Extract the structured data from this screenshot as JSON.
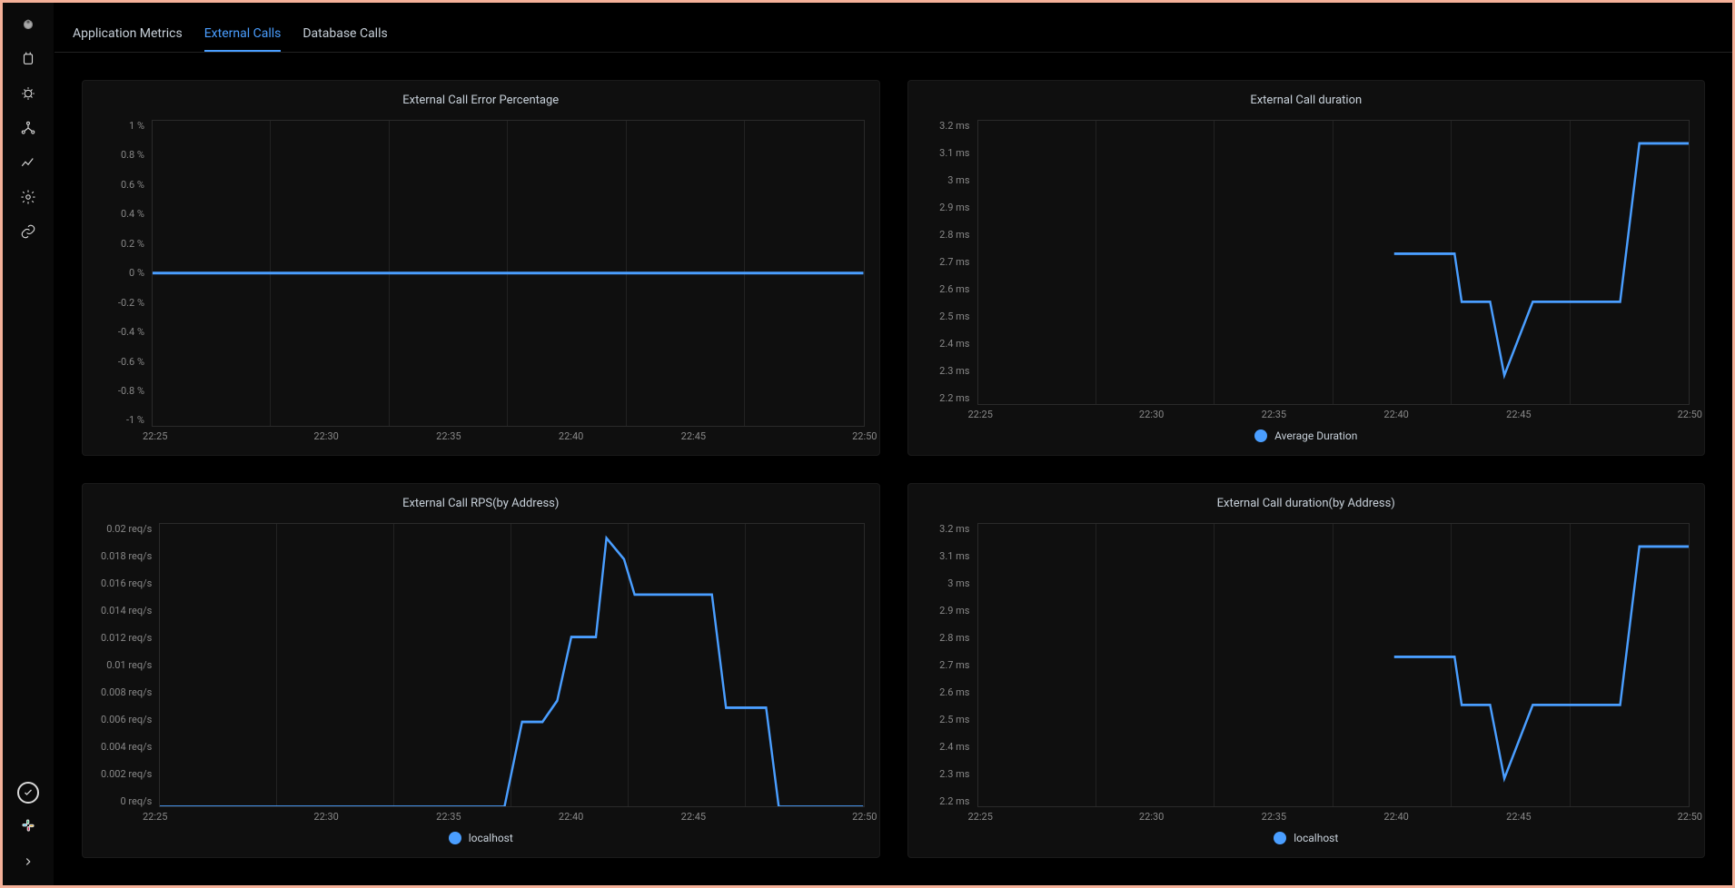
{
  "tabs": [
    {
      "label": "Application Metrics",
      "active": false
    },
    {
      "label": "External Calls",
      "active": true
    },
    {
      "label": "Database Calls",
      "active": false
    }
  ],
  "sidebar": {
    "icons": [
      "dashboard",
      "alerts",
      "bugs",
      "services",
      "metrics",
      "settings",
      "link"
    ]
  },
  "chart_data": [
    {
      "id": "error-pct",
      "type": "line",
      "title": "External Call Error Percentage",
      "ylabel": "",
      "x": [
        "22:25",
        "22:30",
        "22:35",
        "22:40",
        "22:45",
        "22:50"
      ],
      "yticks": [
        "1 %",
        "0.8 %",
        "0.6 %",
        "0.4 %",
        "0.2 %",
        "0 %",
        "-0.2 %",
        "-0.4 %",
        "-0.6 %",
        "-0.8 %",
        "-1 %"
      ],
      "ylim": [
        -1,
        1
      ],
      "series": [
        {
          "name": "",
          "values": [
            0,
            0,
            0,
            0,
            0,
            0,
            0,
            0,
            0,
            0,
            0,
            0,
            0,
            0,
            0,
            0,
            0,
            0,
            0,
            0,
            0,
            0,
            0,
            0,
            0,
            0
          ]
        }
      ],
      "legend": []
    },
    {
      "id": "duration",
      "type": "line",
      "title": "External Call duration",
      "ylabel": "",
      "x": [
        "22:25",
        "22:30",
        "22:35",
        "22:40",
        "22:45",
        "22:50"
      ],
      "yticks": [
        "3.2 ms",
        "3.1 ms",
        "3 ms",
        "2.9 ms",
        "2.8 ms",
        "2.7 ms",
        "2.6 ms",
        "2.5 ms",
        "2.4 ms",
        "2.3 ms",
        "2.2 ms"
      ],
      "ylim": [
        2.2,
        3.2
      ],
      "series": [
        {
          "name": "Average Duration",
          "values_segment": {
            "start_fraction": 0.585,
            "points": [
              [
                0.585,
                2.73
              ],
              [
                0.67,
                2.73
              ],
              [
                0.68,
                2.56
              ],
              [
                0.72,
                2.56
              ],
              [
                0.74,
                2.3
              ],
              [
                0.78,
                2.56
              ],
              [
                0.79,
                2.56
              ],
              [
                0.903,
                2.56
              ],
              [
                0.93,
                3.12
              ],
              [
                1.0,
                3.12
              ]
            ]
          }
        }
      ],
      "legend": [
        "Average Duration"
      ]
    },
    {
      "id": "rps",
      "type": "line",
      "title": "External Call RPS(by Address)",
      "ylabel": "",
      "x": [
        "22:25",
        "22:30",
        "22:35",
        "22:40",
        "22:45",
        "22:50"
      ],
      "yticks": [
        "0.02 req/s",
        "0.018 req/s",
        "0.016 req/s",
        "0.014 req/s",
        "0.012 req/s",
        "0.01 req/s",
        "0.008 req/s",
        "0.006 req/s",
        "0.004 req/s",
        "0.002 req/s",
        "0 req/s"
      ],
      "ylim": [
        0,
        0.02
      ],
      "series": [
        {
          "name": "localhost",
          "values_segment": {
            "start_fraction": 0.0,
            "points": [
              [
                0.0,
                0
              ],
              [
                0.49,
                0
              ],
              [
                0.515,
                0.006
              ],
              [
                0.544,
                0.006
              ],
              [
                0.565,
                0.0075
              ],
              [
                0.585,
                0.012
              ],
              [
                0.62,
                0.012
              ],
              [
                0.635,
                0.019
              ],
              [
                0.66,
                0.0175
              ],
              [
                0.675,
                0.015
              ],
              [
                0.785,
                0.015
              ],
              [
                0.805,
                0.007
              ],
              [
                0.862,
                0.007
              ],
              [
                0.88,
                0
              ],
              [
                1.0,
                0
              ]
            ]
          }
        }
      ],
      "legend": [
        "localhost"
      ]
    },
    {
      "id": "duration-addr",
      "type": "line",
      "title": "External Call duration(by Address)",
      "ylabel": "",
      "x": [
        "22:25",
        "22:30",
        "22:35",
        "22:40",
        "22:45",
        "22:50"
      ],
      "yticks": [
        "3.2 ms",
        "3.1 ms",
        "3 ms",
        "2.9 ms",
        "2.8 ms",
        "2.7 ms",
        "2.6 ms",
        "2.5 ms",
        "2.4 ms",
        "2.3 ms",
        "2.2 ms"
      ],
      "ylim": [
        2.2,
        3.2
      ],
      "series": [
        {
          "name": "localhost",
          "values_segment": {
            "start_fraction": 0.585,
            "points": [
              [
                0.585,
                2.73
              ],
              [
                0.67,
                2.73
              ],
              [
                0.68,
                2.56
              ],
              [
                0.72,
                2.56
              ],
              [
                0.74,
                2.3
              ],
              [
                0.78,
                2.56
              ],
              [
                0.79,
                2.56
              ],
              [
                0.903,
                2.56
              ],
              [
                0.93,
                3.12
              ],
              [
                1.0,
                3.12
              ]
            ]
          }
        }
      ],
      "legend": [
        "localhost"
      ]
    }
  ]
}
